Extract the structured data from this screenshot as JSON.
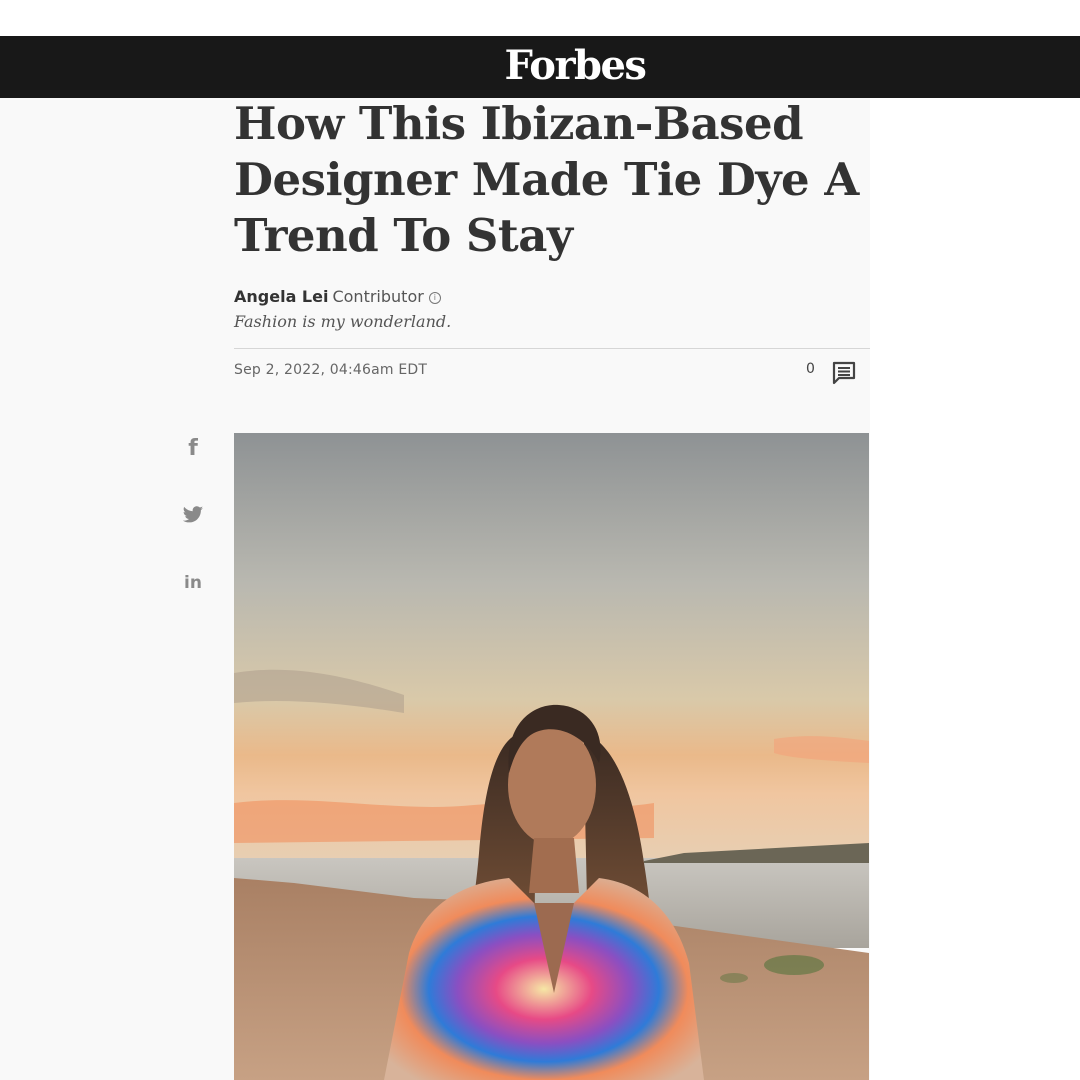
{
  "brand": {
    "name": "Forbes"
  },
  "article": {
    "headline": "How This Ibizan-Based Designer Made Tie Dye A Trend To Stay",
    "author": "Angela Lei",
    "author_role": "Contributor",
    "tagline": "Fashion is my wonderland.",
    "date": "Sep 2, 2022, 04:46am EDT",
    "comment_count": "0"
  },
  "share": {
    "facebook_glyph": "f",
    "linkedin_glyph": "in"
  },
  "icons": {
    "info": "info-icon",
    "comment": "comment-icon",
    "facebook": "facebook-icon",
    "twitter": "twitter-icon",
    "linkedin": "linkedin-icon"
  },
  "colors": {
    "masthead": "#181818",
    "headline": "#333333",
    "background": "#f9f9f9"
  }
}
